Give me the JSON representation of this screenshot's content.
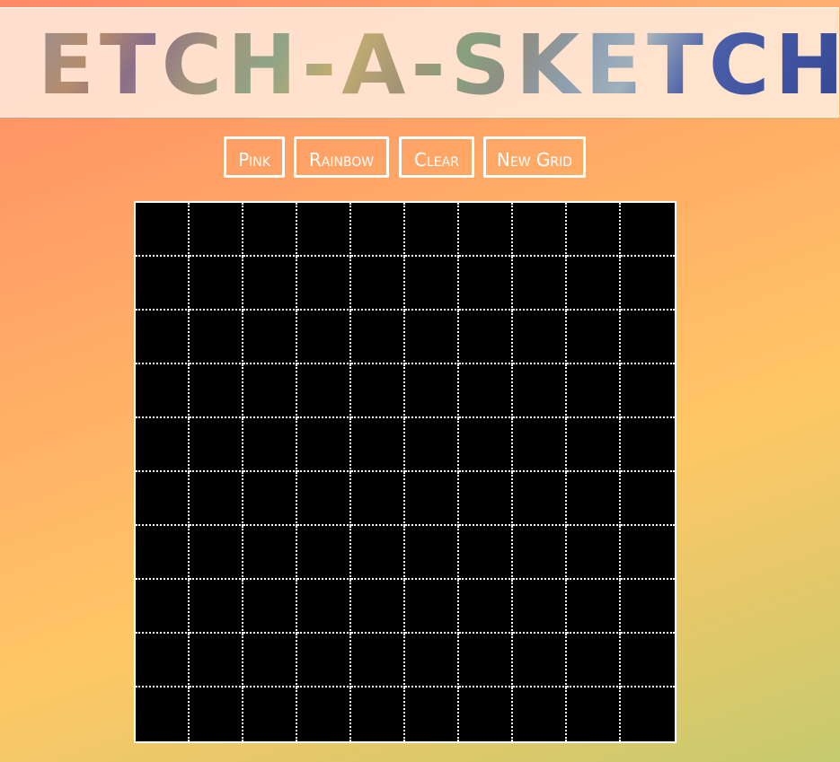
{
  "header": {
    "title": "ETCH-A-SKETCH"
  },
  "controls": {
    "pink_label": "Pink",
    "rainbow_label": "Rainbow",
    "clear_label": "Clear",
    "new_grid_label": "New Grid"
  },
  "grid": {
    "rows": 10,
    "columns": 10,
    "cell_color": "#000000",
    "line_color": "#ffffff",
    "line_style": "dotted"
  },
  "colors": {
    "background_start": "#ff8a65",
    "background_end": "#c6ca6e",
    "header_panel": "#fff0e4",
    "button_border": "#ffffff"
  }
}
